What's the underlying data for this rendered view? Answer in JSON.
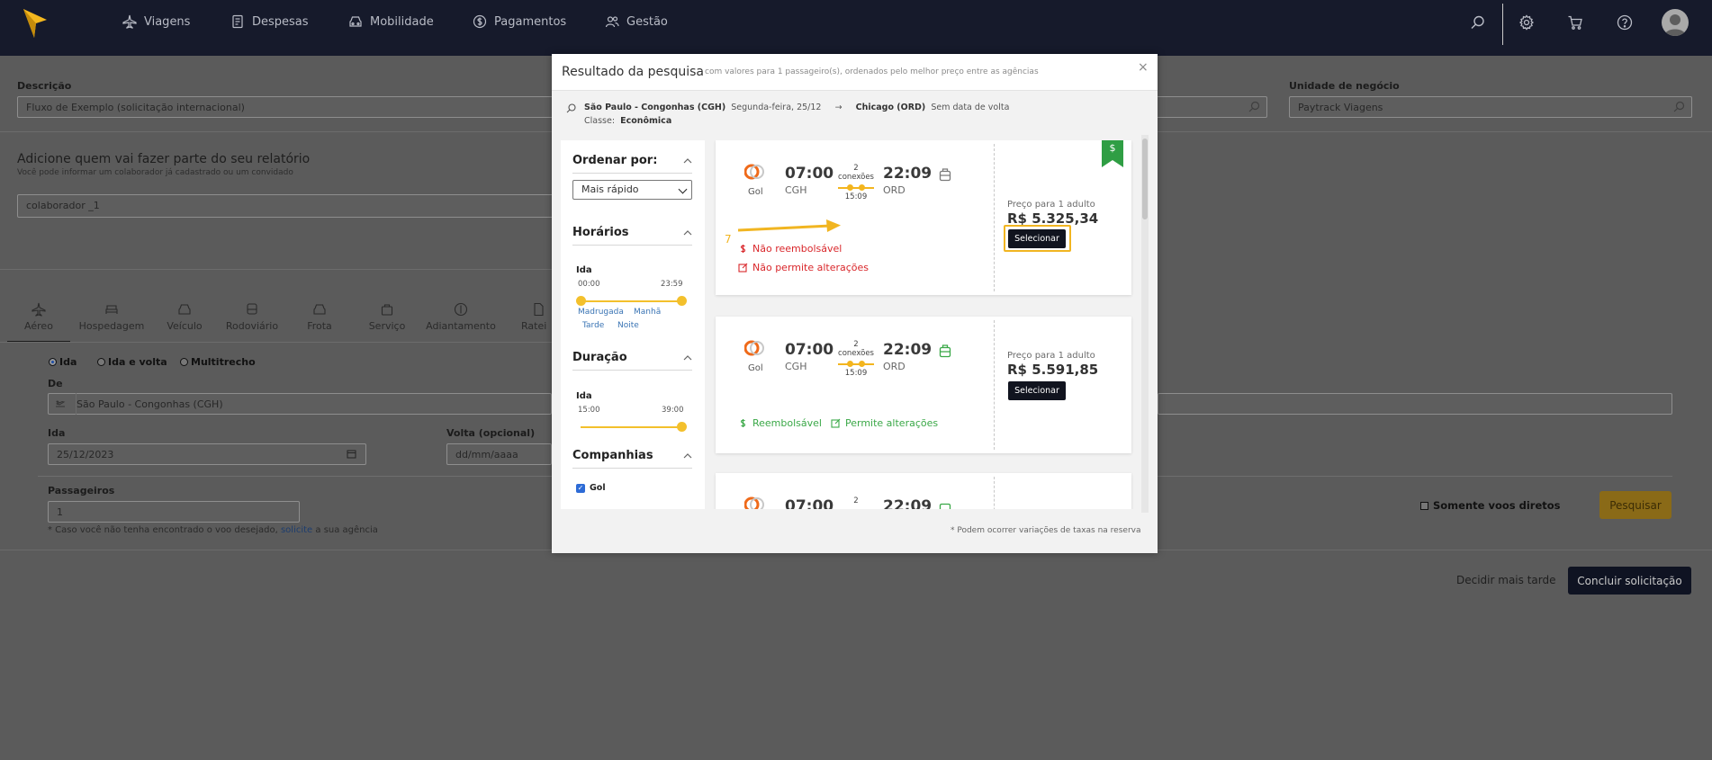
{
  "nav": {
    "items": [
      {
        "label": "Viagens",
        "icon": "plane-icon"
      },
      {
        "label": "Despesas",
        "icon": "receipt-icon"
      },
      {
        "label": "Mobilidade",
        "icon": "car-icon"
      },
      {
        "label": "Pagamentos",
        "icon": "dollar-circle-icon"
      },
      {
        "label": "Gestão",
        "icon": "users-icon"
      }
    ]
  },
  "form": {
    "descricao_label": "Descrição",
    "descricao_value": "Fluxo de Exemplo (solicitação internacional)",
    "unidade_label": "Unidade de negócio",
    "unidade_value": "Paytrack Viagens",
    "participants_heading": "Adicione quem vai fazer parte do seu relatório",
    "participants_help": "Você pode informar um colaborador já cadastrado ou um convidado",
    "participant_value": "colaborador _1",
    "tabs": [
      "Aéreo",
      "Hospedagem",
      "Veículo",
      "Rodoviário",
      "Frota",
      "Serviço",
      "Adiantamento",
      "Ratei"
    ],
    "trip_types": [
      "Ida",
      "Ida e volta",
      "Multitrecho"
    ],
    "de_label": "De",
    "de_value": "São Paulo - Congonhas (CGH)",
    "ida_label": "Ida",
    "ida_value": "25/12/2023",
    "volta_label": "Volta (opcional)",
    "volta_placeholder": "dd/mm/aaaa",
    "passageiros_label": "Passageiros",
    "passageiros_value": "1",
    "note_prefix": "* Caso você não tenha encontrado o voo desejado,",
    "note_link": "solicite",
    "note_suffix": "a sua agência",
    "direct_only_label": "Somente voos diretos",
    "search_button": "Pesquisar",
    "decide_later": "Decidir mais tarde",
    "conclude_button": "Concluir solicitação"
  },
  "modal": {
    "title": "Resultado da pesquisa",
    "subtitle": "com valores para 1 passageiro(s), ordenados pelo melhor preço entre as agências",
    "close": "×",
    "route_from": "São Paulo - Congonhas (CGH)",
    "route_date": "Segunda-feira, 25/12",
    "route_arrow": "→",
    "route_to": "Chicago (ORD)",
    "route_return": "Sem data de volta",
    "class_label": "Classe:",
    "class_value": "Econômica",
    "footnote": "* Podem ocorrer variações de taxas na reserva",
    "filters": {
      "order_title": "Ordenar por:",
      "order_value": "Mais rápido",
      "schedule_title": "Horários",
      "schedule_sub": "Ida",
      "schedule_min": "00:00",
      "schedule_max": "23:59",
      "periods": [
        "Madrugada",
        "Manhã",
        "Tarde",
        "Noite"
      ],
      "duration_title": "Duração",
      "duration_sub": "Ida",
      "duration_min": "15:00",
      "duration_max": "39:00",
      "companies_title": "Companhias",
      "company": "Gol"
    },
    "flights": [
      {
        "airline": "Gol",
        "dep_time": "07:00",
        "dep_code": "CGH",
        "arr_time": "22:09",
        "arr_code": "ORD",
        "conn_count": "2",
        "conn_label": "conexões",
        "conn_duration": "15:09",
        "refund": "Não reembolsável",
        "changes": "Não permite alterações",
        "price_label": "Preço para 1 adulto",
        "price": "R$ 5.325,34",
        "select": "Selecionar",
        "best_price_badge": "$"
      },
      {
        "airline": "Gol",
        "dep_time": "07:00",
        "dep_code": "CGH",
        "arr_time": "22:09",
        "arr_code": "ORD",
        "conn_count": "2",
        "conn_label": "conexões",
        "conn_duration": "15:09",
        "refund": "Reembolsável",
        "changes": "Permite alterações",
        "price_label": "Preço para 1 adulto",
        "price": "R$ 5.591,85",
        "select": "Selecionar"
      },
      {
        "dep_time": "07:00",
        "conn_count": "2",
        "arr_time": "22:09"
      }
    ],
    "annotation_step": "7"
  },
  "colors": {
    "nav_bg": "#161a2b",
    "accent": "#f3b51e",
    "negative": "#d9262a",
    "positive": "#3aa847",
    "dark_button": "#11141f"
  }
}
